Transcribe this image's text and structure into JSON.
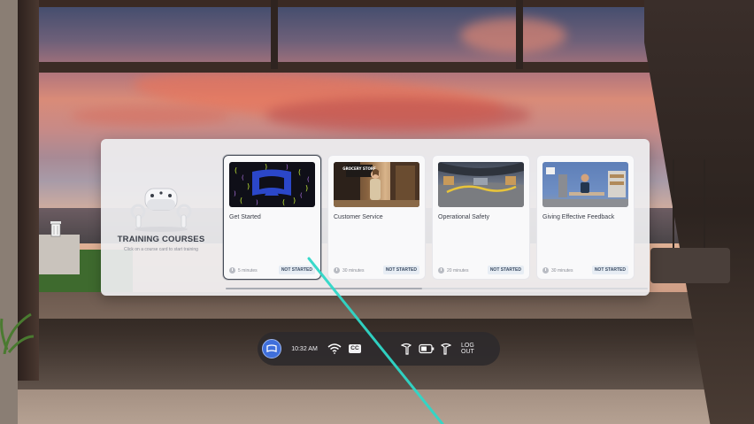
{
  "panel": {
    "title": "TRAINING COURSES",
    "subtitle": "Click on a course card to start training",
    "headset_icon": "vr-headset-controllers-icon"
  },
  "courses": [
    {
      "title": "Get Started",
      "duration": "5 minutes",
      "status": "NOT STARTED",
      "thumbnail": "headset-view-icon"
    },
    {
      "title": "Customer Service",
      "duration": "30 minutes",
      "status": "NOT STARTED",
      "thumbnail": "grocery-store-scene"
    },
    {
      "title": "Operational Safety",
      "duration": "20 minutes",
      "status": "NOT STARTED",
      "thumbnail": "warehouse-panorama"
    },
    {
      "title": "Giving Effective Feedback",
      "duration": "30 minutes",
      "status": "NOT STARTED",
      "thumbnail": "office-scene"
    }
  ],
  "customer_service_sign": "GROCERY STORE",
  "dock": {
    "time": "10:32 AM",
    "cc_label": "CC",
    "logout_label": "LOG OUT",
    "icons": [
      "menu-icon",
      "wifi-icon",
      "closed-captions-icon",
      "left-controller-icon",
      "battery-icon",
      "right-controller-icon"
    ]
  },
  "colors": {
    "accent": "#3f6fdb",
    "laser": "#2fd8c8",
    "badge_bg": "#e7edf4",
    "badge_text": "#3a4b62"
  }
}
